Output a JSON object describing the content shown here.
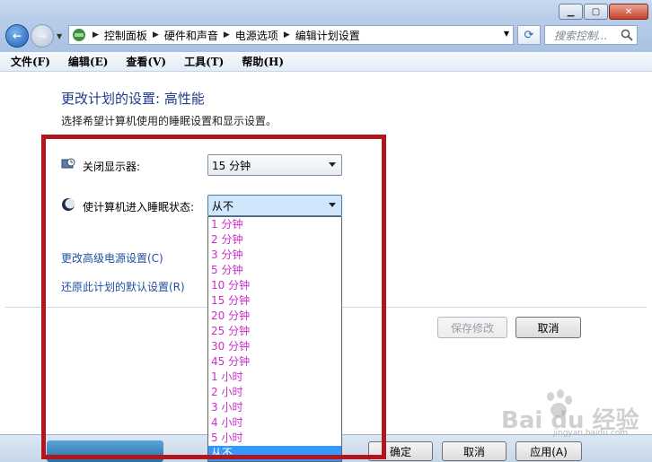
{
  "address": {
    "crumbs": [
      "控制面板",
      "硬件和声音",
      "电源选项",
      "编辑计划设置"
    ]
  },
  "search": {
    "placeholder": "搜索控制..."
  },
  "menu": [
    "文件(F)",
    "编辑(E)",
    "查看(V)",
    "工具(T)",
    "帮助(H)"
  ],
  "page": {
    "title": "更改计划的设置: 高性能",
    "description": "选择希望计算机使用的睡眠设置和显示设置。"
  },
  "settings": {
    "display_off_label": "关闭显示器:",
    "display_off_value": "15 分钟",
    "sleep_label": "使计算机进入睡眠状态:",
    "sleep_value": "从不"
  },
  "sleep_options": [
    "1 分钟",
    "2 分钟",
    "3 分钟",
    "5 分钟",
    "10 分钟",
    "15 分钟",
    "20 分钟",
    "25 分钟",
    "30 分钟",
    "45 分钟",
    "1 小时",
    "2 小时",
    "3 小时",
    "4 小时",
    "5 小时",
    "从不"
  ],
  "selected_option_index": 15,
  "links": {
    "advanced": "更改高级电源设置(C)",
    "restore": "还原此计划的默认设置(R)"
  },
  "buttons": {
    "save": "保存修改",
    "cancel": "取消"
  },
  "bottom_buttons": {
    "ok": "确定",
    "cancel": "取消",
    "apply": "应用(A)"
  },
  "watermark": {
    "brand": "Bai du 经验",
    "sub": "jingyan.baidu.com"
  },
  "colors": {
    "link": "#1f4f9e",
    "title": "#1e3a8a",
    "option_text": "#c92fc9",
    "highlight": "#3399ff",
    "annotation": "#b1161d"
  }
}
